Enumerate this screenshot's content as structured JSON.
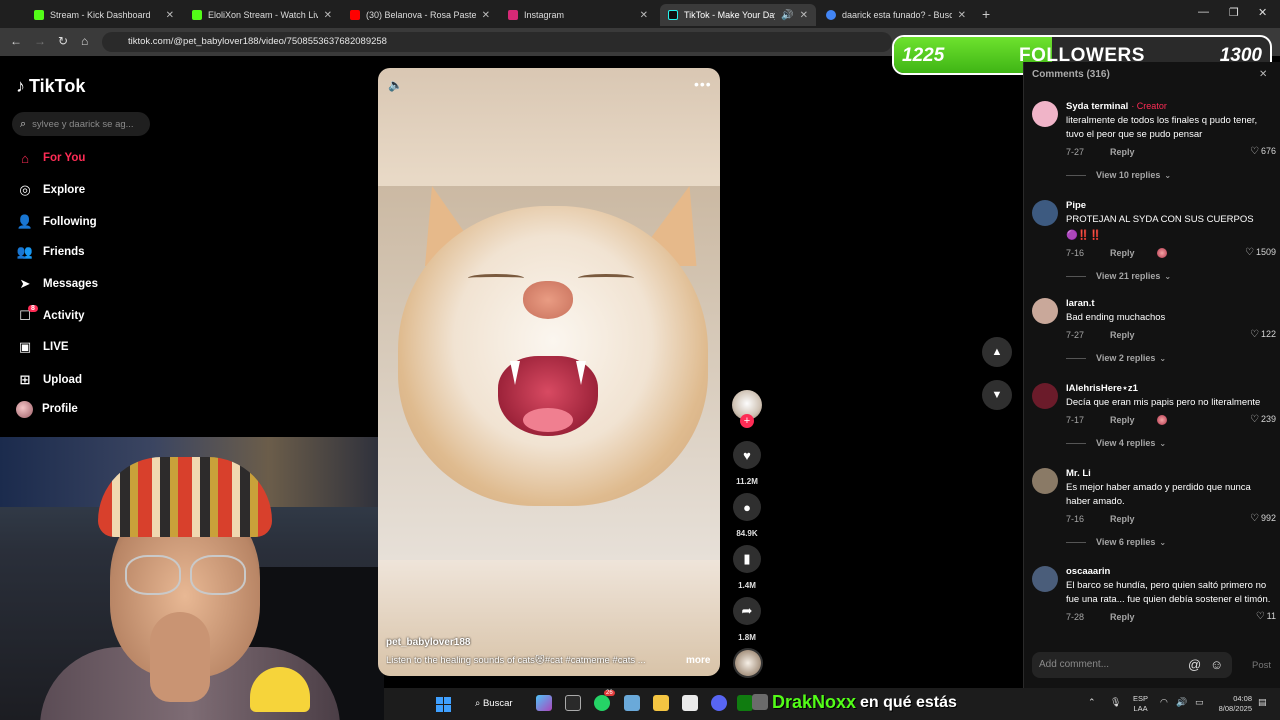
{
  "browser": {
    "tabs": [
      {
        "label": "Stream - Kick Dashboard",
        "color": "#53fc18"
      },
      {
        "label": "EloliXon Stream - Watch Live on Kick",
        "color": "#53fc18"
      },
      {
        "label": "(30) Belanova - Rosa Pastel (Lyric Video)",
        "color": "#ff0000"
      },
      {
        "label": "Instagram",
        "color": "#d62976"
      },
      {
        "label": "TikTok - Make Your Day",
        "color": "#111111"
      },
      {
        "label": "daarick esta funado? - Buscar con Google",
        "color": "#4285f4"
      }
    ],
    "new_tab": "+",
    "url": "tiktok.com/@pet_babylover188/video/7508553637682089258"
  },
  "overlay": {
    "followers_start": "1225",
    "followers_label": "FOLLOWERS",
    "followers_goal": "1300",
    "followers_progress": 0.42,
    "kick_count": "10"
  },
  "tiktok": {
    "logo": "TikTok",
    "search_placeholder": "sylvee y daarick se ag...",
    "nav": [
      {
        "label": "For You",
        "icon": "home-icon",
        "active": true
      },
      {
        "label": "Explore",
        "icon": "compass-icon"
      },
      {
        "label": "Following",
        "icon": "following-icon"
      },
      {
        "label": "Friends",
        "icon": "friends-icon"
      },
      {
        "label": "Messages",
        "icon": "messages-icon"
      },
      {
        "label": "Activity",
        "icon": "activity-icon",
        "badge": "8"
      },
      {
        "label": "LIVE",
        "icon": "live-icon"
      },
      {
        "label": "Upload",
        "icon": "upload-icon"
      },
      {
        "label": "Profile",
        "icon": "avatar"
      }
    ]
  },
  "video": {
    "author": "pet_babylover188",
    "caption": "Listen to the healing sounds of cats😻#cat  #catmeme  #cats  ...",
    "more_label": "more",
    "likes": "11.2M",
    "comments": "84.9K",
    "saves": "1.4M",
    "shares": "1.8M"
  },
  "comments": {
    "title": "Comments (316)",
    "items": [
      {
        "name": "Syda terminal",
        "creator": "· Creator",
        "text": "literalmente de todos los finales q pudo tener, tuvo el peor que se pudo pensar",
        "date": "7-27",
        "likes": "676",
        "replies": "View 10 replies",
        "avatar": "#f0b4c8"
      },
      {
        "name": "Pipe",
        "text": "PROTEJAN AL SYDA CON SUS CUERPOS",
        "extra": "🟣‼️‼️",
        "date": "7-16",
        "likes": "1509",
        "replies": "View 21 replies",
        "avatar": "#3d5a80",
        "creator_liked": true
      },
      {
        "name": "laran.t",
        "text": "Bad ending muchachos",
        "date": "7-27",
        "likes": "122",
        "replies": "View 2 replies",
        "avatar": "#c9a89a"
      },
      {
        "name": "IAlehrisHere⋆z1",
        "text": "Decía que eran mis papis pero no literalmente",
        "date": "7-17",
        "likes": "239",
        "replies": "View 4 replies",
        "avatar": "#6b1b2a",
        "creator_liked": true
      },
      {
        "name": "Mr. Li",
        "text": "Es mejor haber amado y perdido que nunca haber amado.",
        "date": "7-16",
        "likes": "992",
        "replies": "View 6 replies",
        "avatar": "#8a7a66"
      },
      {
        "name": "oscaaarin",
        "text": "El barco se hundía, pero quien saltó primero no fue una rata... fue quien debía sostener el timón.",
        "date": "7-28",
        "likes": "11",
        "avatar": "#4a5d7a"
      }
    ],
    "reply_label": "Reply",
    "input_placeholder": "Add comment...",
    "post_label": "Post"
  },
  "taskbar": {
    "search_label": "Buscar",
    "notif_count": "26",
    "chat_name": "DrakNoxx",
    "chat_msg": "en qué estás",
    "lang_1": "ESP",
    "lang_2": "LAA",
    "time": "04:08",
    "date": "8/08/2025"
  }
}
